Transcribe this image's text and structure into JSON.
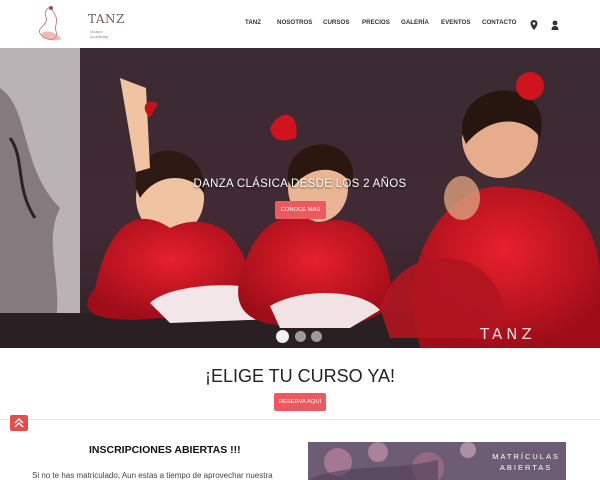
{
  "header": {
    "logo_text": "TANZ",
    "logo_sub": "Dance Academy",
    "nav": [
      "TANZ",
      "NOSOTROS",
      "CURSOS",
      "PRECIOS",
      "GALERÍA",
      "EVENTOS",
      "CONTACTO"
    ],
    "icons": [
      "location-icon",
      "user-icon"
    ]
  },
  "hero": {
    "title": "DANZA CLÁSICA DESDE LOS 2 AÑOS",
    "button": "CONOCE MAS",
    "watermark": "TANZ",
    "slide_count": 3,
    "active_slide": 1
  },
  "course": {
    "title": "¡ELIGE TU CURSO YA!",
    "button": "RESERVA AQUÍ"
  },
  "inscripciones": {
    "title": "INSCRIPCIONES ABIERTAS !!!",
    "text": "Si no te has matriculado, Aun estas a tiempo de aprovechar nuestra"
  },
  "banner": {
    "line1": "MATRÍCULAS",
    "line2": "ABIERTAS"
  },
  "colors": {
    "accent": "#ea5a5f",
    "scroll_top": "#e74c4c"
  }
}
